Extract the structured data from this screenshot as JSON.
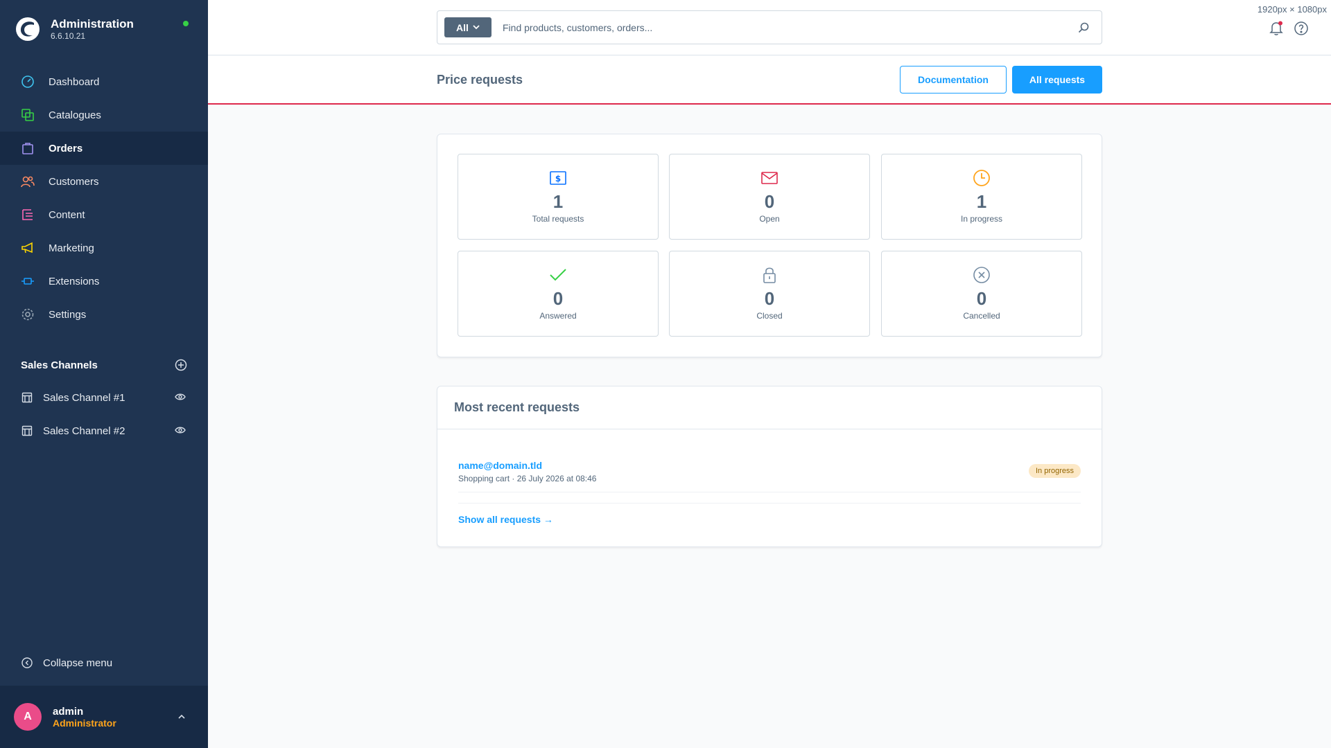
{
  "app": {
    "title": "Administration",
    "version": "6.6.10.21",
    "status_color": "#37d046"
  },
  "nav": {
    "items": [
      {
        "label": "Dashboard",
        "icon": "gauge-icon",
        "color": "#3fc5f0"
      },
      {
        "label": "Catalogues",
        "icon": "products-icon",
        "color": "#37d046"
      },
      {
        "label": "Orders",
        "icon": "bag-icon",
        "color": "#a092f0",
        "active": true
      },
      {
        "label": "Customers",
        "icon": "users-icon",
        "color": "#f88962"
      },
      {
        "label": "Content",
        "icon": "content-icon",
        "color": "#ff68b4"
      },
      {
        "label": "Marketing",
        "icon": "megaphone-icon",
        "color": "#ffd700"
      },
      {
        "label": "Extensions",
        "icon": "plug-icon",
        "color": "#189eff"
      },
      {
        "label": "Settings",
        "icon": "gear-icon",
        "color": "#9aa8b5"
      }
    ]
  },
  "sales_channels": {
    "title": "Sales Channels",
    "items": [
      {
        "label": "Sales Channel #1"
      },
      {
        "label": "Sales Channel #2"
      }
    ]
  },
  "collapse_label": "Collapse menu",
  "user": {
    "initial": "A",
    "name": "admin",
    "role": "Administrator"
  },
  "search": {
    "type": "All",
    "placeholder": "Find products, customers, orders..."
  },
  "viewport_label": "1920px × 1080px",
  "page": {
    "title": "Price requests",
    "doc_button": "Documentation",
    "all_button": "All requests"
  },
  "stats": [
    {
      "value": "1",
      "label": "Total requests",
      "icon": "dollar-icon",
      "color": "#0870ff"
    },
    {
      "value": "0",
      "label": "Open",
      "icon": "envelope-icon",
      "color": "#de294c"
    },
    {
      "value": "1",
      "label": "In progress",
      "icon": "clock-icon",
      "color": "#ffa41b"
    },
    {
      "value": "0",
      "label": "Answered",
      "icon": "checkmark-icon",
      "color": "#37d046"
    },
    {
      "value": "0",
      "label": "Closed",
      "icon": "lock-icon",
      "color": "#758ca3"
    },
    {
      "value": "0",
      "label": "Cancelled",
      "icon": "x-circle-icon",
      "color": "#758ca3"
    }
  ],
  "recent": {
    "title": "Most recent requests",
    "items": [
      {
        "email": "name@domain.tld",
        "meta": "Shopping cart · 26 July 2026 at 08:46",
        "status": "In progress"
      }
    ],
    "show_all": "Show all requests →"
  }
}
